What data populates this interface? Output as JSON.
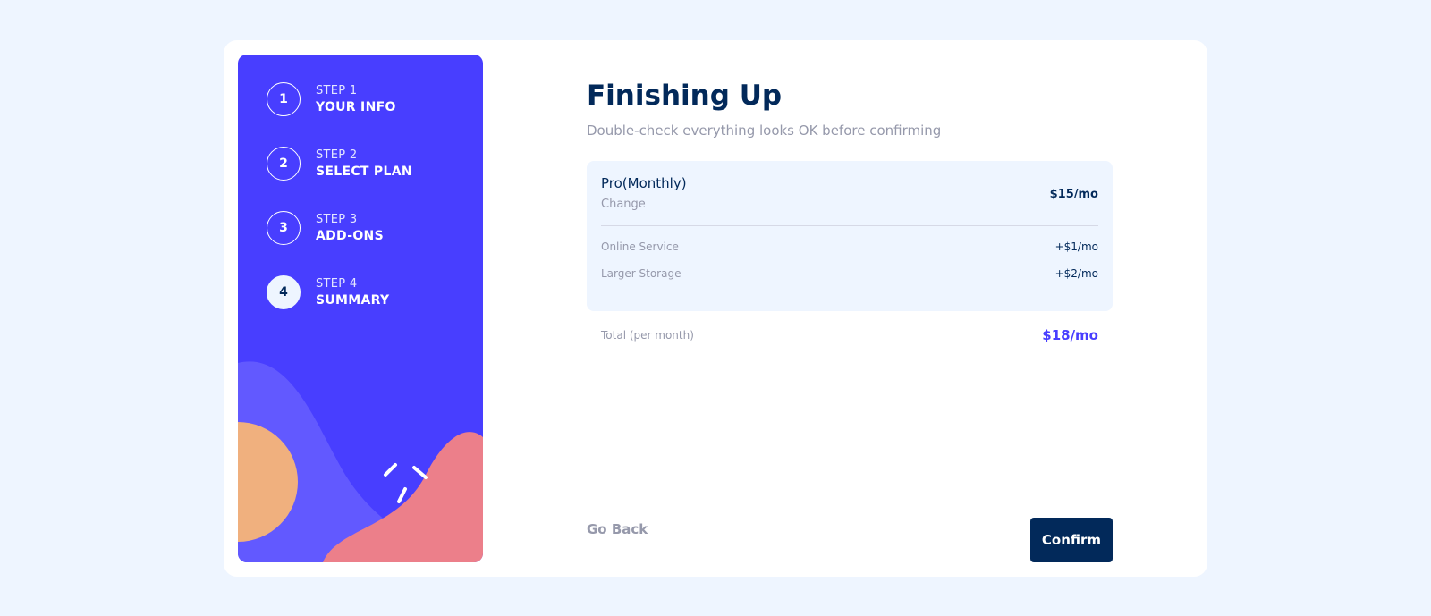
{
  "steps": [
    {
      "number": "1",
      "label": "STEP 1",
      "title": "YOUR INFO",
      "active": false
    },
    {
      "number": "2",
      "label": "STEP 2",
      "title": "SELECT PLAN",
      "active": false
    },
    {
      "number": "3",
      "label": "STEP 3",
      "title": "ADD-ONS",
      "active": false
    },
    {
      "number": "4",
      "label": "STEP 4",
      "title": "SUMMARY",
      "active": true
    }
  ],
  "main": {
    "title": "Finishing Up",
    "subtitle": "Double-check everything looks OK before confirming"
  },
  "summary": {
    "plan_name": "Pro(Monthly)",
    "change_label": "Change",
    "plan_price": "$15/mo",
    "addons": [
      {
        "name": "Online Service",
        "price": "+$1/mo"
      },
      {
        "name": "Larger Storage",
        "price": "+$2/mo"
      }
    ]
  },
  "total": {
    "label": "Total (per month)",
    "value": "$18/mo"
  },
  "buttons": {
    "go_back": "Go Back",
    "confirm": "Confirm"
  },
  "colors": {
    "page_background": "#eef5ff",
    "sidebar": "#483eff",
    "marine_blue": "#02295a",
    "accent": "#483eff",
    "cool_gray": "#9699ab",
    "illustration_purple": "#6259ff",
    "illustration_orange": "#ffaf7e",
    "illustration_pink": "#f9818e"
  }
}
